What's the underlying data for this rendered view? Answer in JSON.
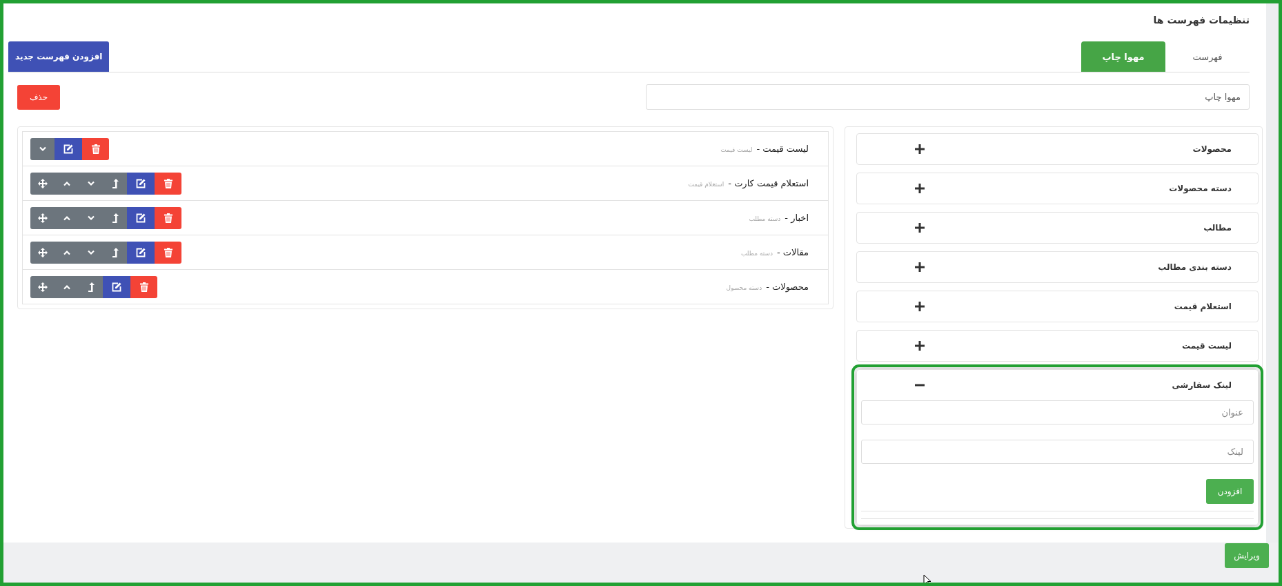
{
  "page_title": "تنظیمات فهرست ها",
  "tabs": [
    {
      "label": "فهرست",
      "selected": false
    },
    {
      "label": "مهوا چاپ",
      "selected": true
    }
  ],
  "add_menu_button": "افزودن فهرست جدید",
  "menu_name_field": {
    "value": "مهوا چاپ"
  },
  "delete_button": "حذف",
  "menu_items": [
    {
      "title": "لیست قیمت -",
      "type": "لیست قیمت",
      "actions": [
        {
          "kind": "down"
        },
        {
          "kind": "edit"
        },
        {
          "kind": "delete"
        }
      ]
    },
    {
      "title": "استعلام قیمت کارت -",
      "type": "استعلام قیمت",
      "actions": [
        {
          "kind": "move"
        },
        {
          "kind": "up"
        },
        {
          "kind": "down"
        },
        {
          "kind": "outdent"
        },
        {
          "kind": "edit"
        },
        {
          "kind": "delete"
        }
      ]
    },
    {
      "title": "اخبار -",
      "type": "دسته مطلب",
      "actions": [
        {
          "kind": "move"
        },
        {
          "kind": "up"
        },
        {
          "kind": "down"
        },
        {
          "kind": "outdent"
        },
        {
          "kind": "edit"
        },
        {
          "kind": "delete"
        }
      ]
    },
    {
      "title": "مقالات -",
      "type": "دسته مطلب",
      "actions": [
        {
          "kind": "move"
        },
        {
          "kind": "up"
        },
        {
          "kind": "down"
        },
        {
          "kind": "outdent"
        },
        {
          "kind": "edit"
        },
        {
          "kind": "delete"
        }
      ]
    },
    {
      "title": "محصولات -",
      "type": "دسته محصول",
      "actions": [
        {
          "kind": "move"
        },
        {
          "kind": "up"
        },
        {
          "kind": "outdent"
        },
        {
          "kind": "edit"
        },
        {
          "kind": "delete"
        }
      ]
    }
  ],
  "sources": [
    {
      "label": "محصولات",
      "expanded": false,
      "highlighted": false
    },
    {
      "label": "دسته محصولات",
      "expanded": false,
      "highlighted": false
    },
    {
      "label": "مطالب",
      "expanded": false,
      "highlighted": false
    },
    {
      "label": "دسته بندی مطالب",
      "expanded": false,
      "highlighted": false
    },
    {
      "label": "استعلام قیمت",
      "expanded": false,
      "highlighted": false
    },
    {
      "label": "لیست قیمت",
      "expanded": false,
      "highlighted": false
    },
    {
      "label": "لینک سفارشی",
      "expanded": true,
      "highlighted": true,
      "fields": [
        {
          "placeholder": "عنوان"
        },
        {
          "placeholder": "لینک"
        }
      ],
      "add_button": "افزودن"
    }
  ],
  "save_button": "ویرایش"
}
